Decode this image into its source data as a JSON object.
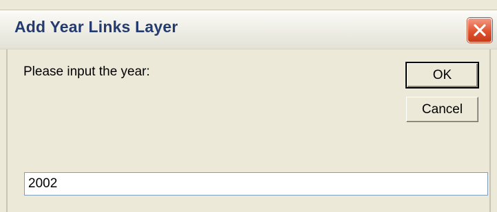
{
  "dialog": {
    "title": "Add Year Links Layer",
    "prompt": "Please input the year:",
    "ok_label": "OK",
    "cancel_label": "Cancel",
    "input_value": "2002",
    "close_icon": "close-icon"
  },
  "colors": {
    "title_text": "#243b70",
    "window_bg": "#ece9d8",
    "close_button": "#e0532f",
    "input_border": "#7f9db9"
  }
}
